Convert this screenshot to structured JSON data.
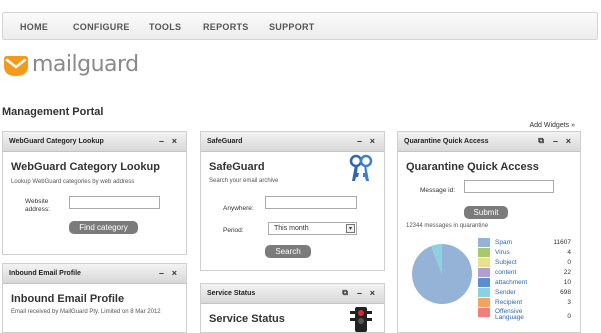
{
  "nav": {
    "items": [
      "HOME",
      "CONFIGURE",
      "TOOLS",
      "REPORTS",
      "SUPPORT"
    ]
  },
  "logo": {
    "text": "mailguard",
    "brand_color": "#f39a1c"
  },
  "portal_title": "Management Portal",
  "add_widgets": "Add Widgets »",
  "controls": {
    "minimize": "–",
    "close": "×",
    "popout": "⧉"
  },
  "webguard": {
    "header": "WebGuard Category Lookup",
    "title": "WebGuard Category Lookup",
    "subtitle": "Lookup WebGuard categories by web address",
    "website_label": "Website address:",
    "website_value": "",
    "find_button": "Find category"
  },
  "safeguard": {
    "header": "SafeGuard",
    "title": "SafeGuard",
    "subtitle": "Search your email archive",
    "anywhere_label": "Anywhere:",
    "anywhere_value": "",
    "period_label": "Period:",
    "period_value": "This month",
    "search_button": "Search"
  },
  "quarantine": {
    "header": "Quarantine Quick Access",
    "title": "Quarantine Quick Access",
    "message_id_label": "Message id:",
    "message_id_value": "",
    "submit_button": "Submit",
    "count_text": "12344 messages in quarantine"
  },
  "inbound": {
    "header": "Inbound Email Profile",
    "title": "Inbound Email Profile",
    "subtitle": "Email received by MailGuard Pty. Limited on 8 Mar 2012"
  },
  "service_status": {
    "header": "Service Status",
    "title": "Service Status"
  },
  "chart_data": {
    "type": "pie",
    "title": "",
    "categories": [
      "Spam",
      "Virus",
      "Subject",
      "content",
      "attachment",
      "Sender",
      "Recipient",
      "Offensive Language"
    ],
    "values": [
      11607,
      4,
      0,
      22,
      10,
      698,
      3,
      0
    ],
    "colors": [
      "#95b3d7",
      "#a7c96b",
      "#e8e08a",
      "#b09fcf",
      "#5b8fd1",
      "#8ad3de",
      "#f4a460",
      "#f08080"
    ],
    "legend": "right"
  }
}
